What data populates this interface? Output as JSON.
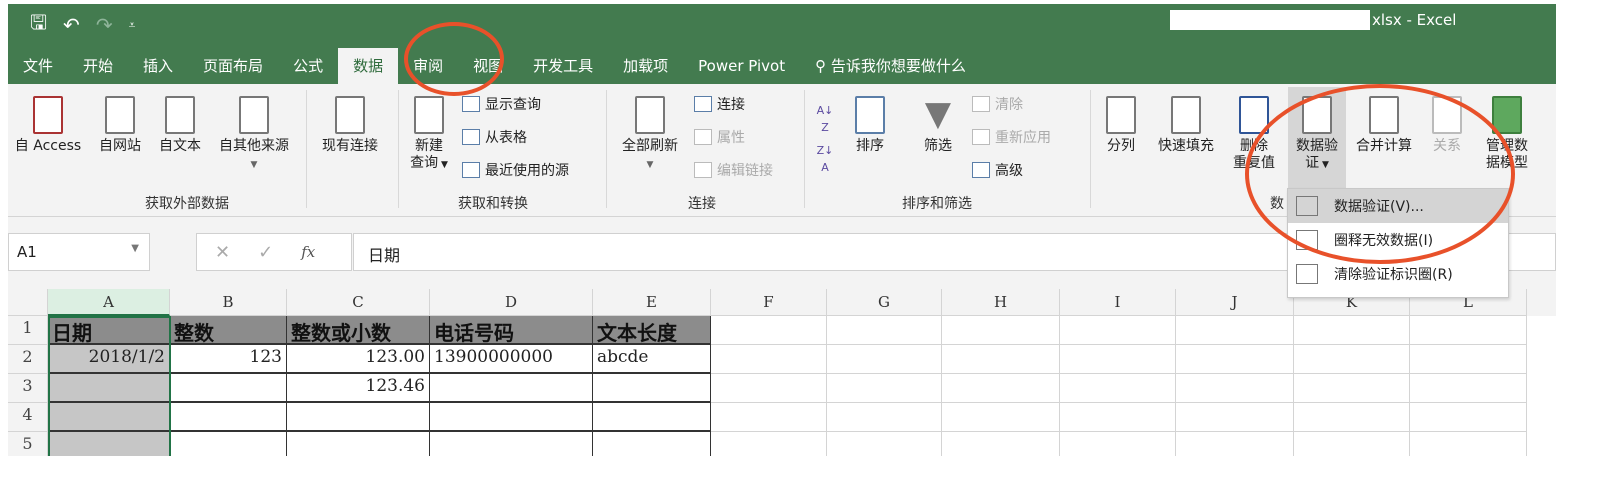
{
  "title": "xlsx - Excel",
  "qat": {
    "save": "🖫",
    "undo": "↶",
    "redo": "↷",
    "customize": "⩡"
  },
  "tabs": [
    "文件",
    "开始",
    "插入",
    "页面布局",
    "公式",
    "数据",
    "审阅",
    "视图",
    "开发工具",
    "加载项",
    "Power Pivot"
  ],
  "tell_me": "告诉我你想要做什么",
  "ribbon": {
    "get_external": {
      "label": "获取外部数据",
      "access": "自 Access",
      "web": "自网站",
      "text": "自文本",
      "other": "自其他来源",
      "existing": "现有连接"
    },
    "get_transform": {
      "label": "获取和转换",
      "new_query_1": "新建",
      "new_query_2": "查询",
      "show_queries": "显示查询",
      "from_table": "从表格",
      "recent_sources": "最近使用的源"
    },
    "connections": {
      "label": "连接",
      "refresh_all": "全部刷新",
      "connections": "连接",
      "properties": "属性",
      "edit_links": "编辑链接"
    },
    "sort_filter": {
      "label": "排序和筛选",
      "sort": "排序",
      "filter": "筛选",
      "clear": "清除",
      "reapply": "重新应用",
      "advanced": "高级"
    },
    "data_tools": {
      "label": "数",
      "text_to_columns": "分列",
      "flash_fill": "快速填充",
      "remove_dup_1": "删除",
      "remove_dup_2": "重复值",
      "validation_1": "数据验",
      "validation_2": "证",
      "consolidate": "合并计算",
      "relationships": "关系",
      "manage_model_1": "管理数",
      "manage_model_2": "据模型"
    }
  },
  "dropdown": [
    "数据验证(V)...",
    "圈释无效数据(I)",
    "清除验证标识圈(R)"
  ],
  "formula_bar": {
    "name_box": "A1",
    "value": "日期",
    "fx": "fx",
    "cancel": "✕",
    "enter": "✓"
  },
  "columns": [
    "A",
    "B",
    "C",
    "D",
    "E",
    "F",
    "G",
    "H",
    "I",
    "J",
    "K",
    "L"
  ],
  "rows": [
    {
      "num": "1",
      "cells": [
        "日期",
        "整数",
        "整数或小数",
        "电话号码",
        "文本长度"
      ]
    },
    {
      "num": "2",
      "cells": [
        "2018/1/2",
        "123",
        "123.00",
        "13900000000",
        "abcde"
      ]
    },
    {
      "num": "3",
      "cells": [
        "",
        "",
        "123.46",
        "",
        ""
      ]
    },
    {
      "num": "4",
      "cells": [
        "",
        "",
        "",
        "",
        ""
      ]
    },
    {
      "num": "5",
      "cells": [
        "",
        "",
        "",
        "",
        ""
      ]
    }
  ],
  "colors": {
    "excel_green": "#437b4f",
    "annotation": "#e8512a"
  }
}
